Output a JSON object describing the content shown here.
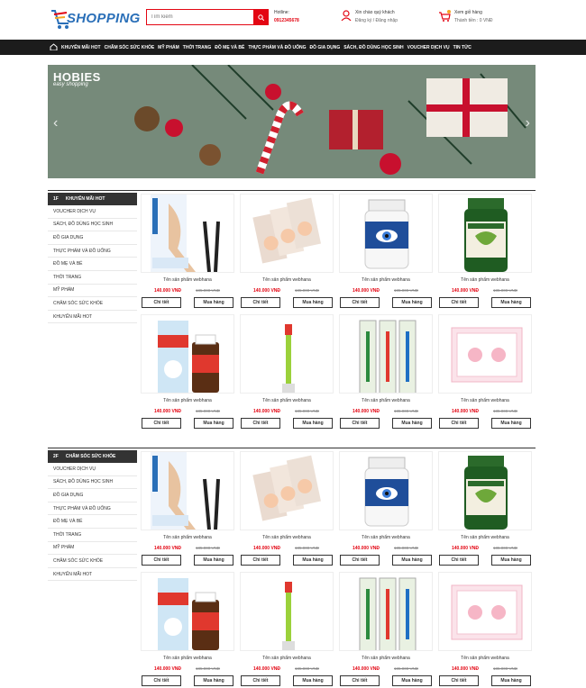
{
  "header": {
    "logo_text": "SHOPPING",
    "search_placeholder": "Tìm kiếm",
    "hotline_label": "Hotline:",
    "hotline_number": "0912345678",
    "account_greeting": "Xin chào quý khách",
    "account_links": "Đăng ký / Đăng nhập",
    "cart_label": "Xem giỏ hàng",
    "cart_total": "Thành tiền : 0 VNĐ"
  },
  "nav": {
    "items": [
      "KHUYẾN MÃI HOT",
      "CHĂM SÓC SỨC KHỎE",
      "MỸ PHẨM",
      "THỜI TRANG",
      "ĐỒ MẸ VÀ BÉ",
      "THỰC PHẨM VÀ ĐỒ UỐNG",
      "ĐỒ GIA DỤNG",
      "SÁCH, ĐỒ DÙNG HỌC SINH",
      "VOUCHER DỊCH VỤ",
      "TIN TỨC"
    ]
  },
  "banner": {
    "brand": "HOBIES",
    "tagline": "easy shopping"
  },
  "sections": [
    {
      "floor": "1F",
      "title": "KHUYẾN MÃI HOT",
      "menu": [
        "VOUCHER DỊCH VỤ",
        "SÁCH, ĐỒ DÙNG HỌC SINH",
        "ĐỒ GIA DỤNG",
        "THỰC PHẨM VÀ ĐỒ UỐNG",
        "ĐỒ MẸ VÀ BÉ",
        "THỜI TRANG",
        "MỸ PHẨM",
        "CHĂM SÓC SỨC KHỎE",
        "KHUYẾN MÃI HOT"
      ]
    },
    {
      "floor": "2F",
      "title": "CHĂM SÓC SỨC KHỎE",
      "menu": [
        "VOUCHER DỊCH VỤ",
        "SÁCH, ĐỒ DÙNG HỌC SINH",
        "ĐỒ GIA DỤNG",
        "THỰC PHẨM VÀ ĐỒ UỐNG",
        "ĐỒ MẸ VÀ BÉ",
        "THỜI TRANG",
        "MỸ PHẨM",
        "CHĂM SÓC SỨC KHỎE",
        "KHUYẾN MÃI HOT"
      ]
    }
  ],
  "product": {
    "name": "Tên sản phẩm webhana",
    "price": "140.000 VNĐ",
    "old_price": "185.000 VNĐ",
    "detail_label": "Chi tiết",
    "buy_label": "Mua hàng"
  },
  "colors": {
    "accent": "#e30613",
    "nav_bg": "#1c1c1c",
    "brand_blue": "#2a6fb8"
  }
}
